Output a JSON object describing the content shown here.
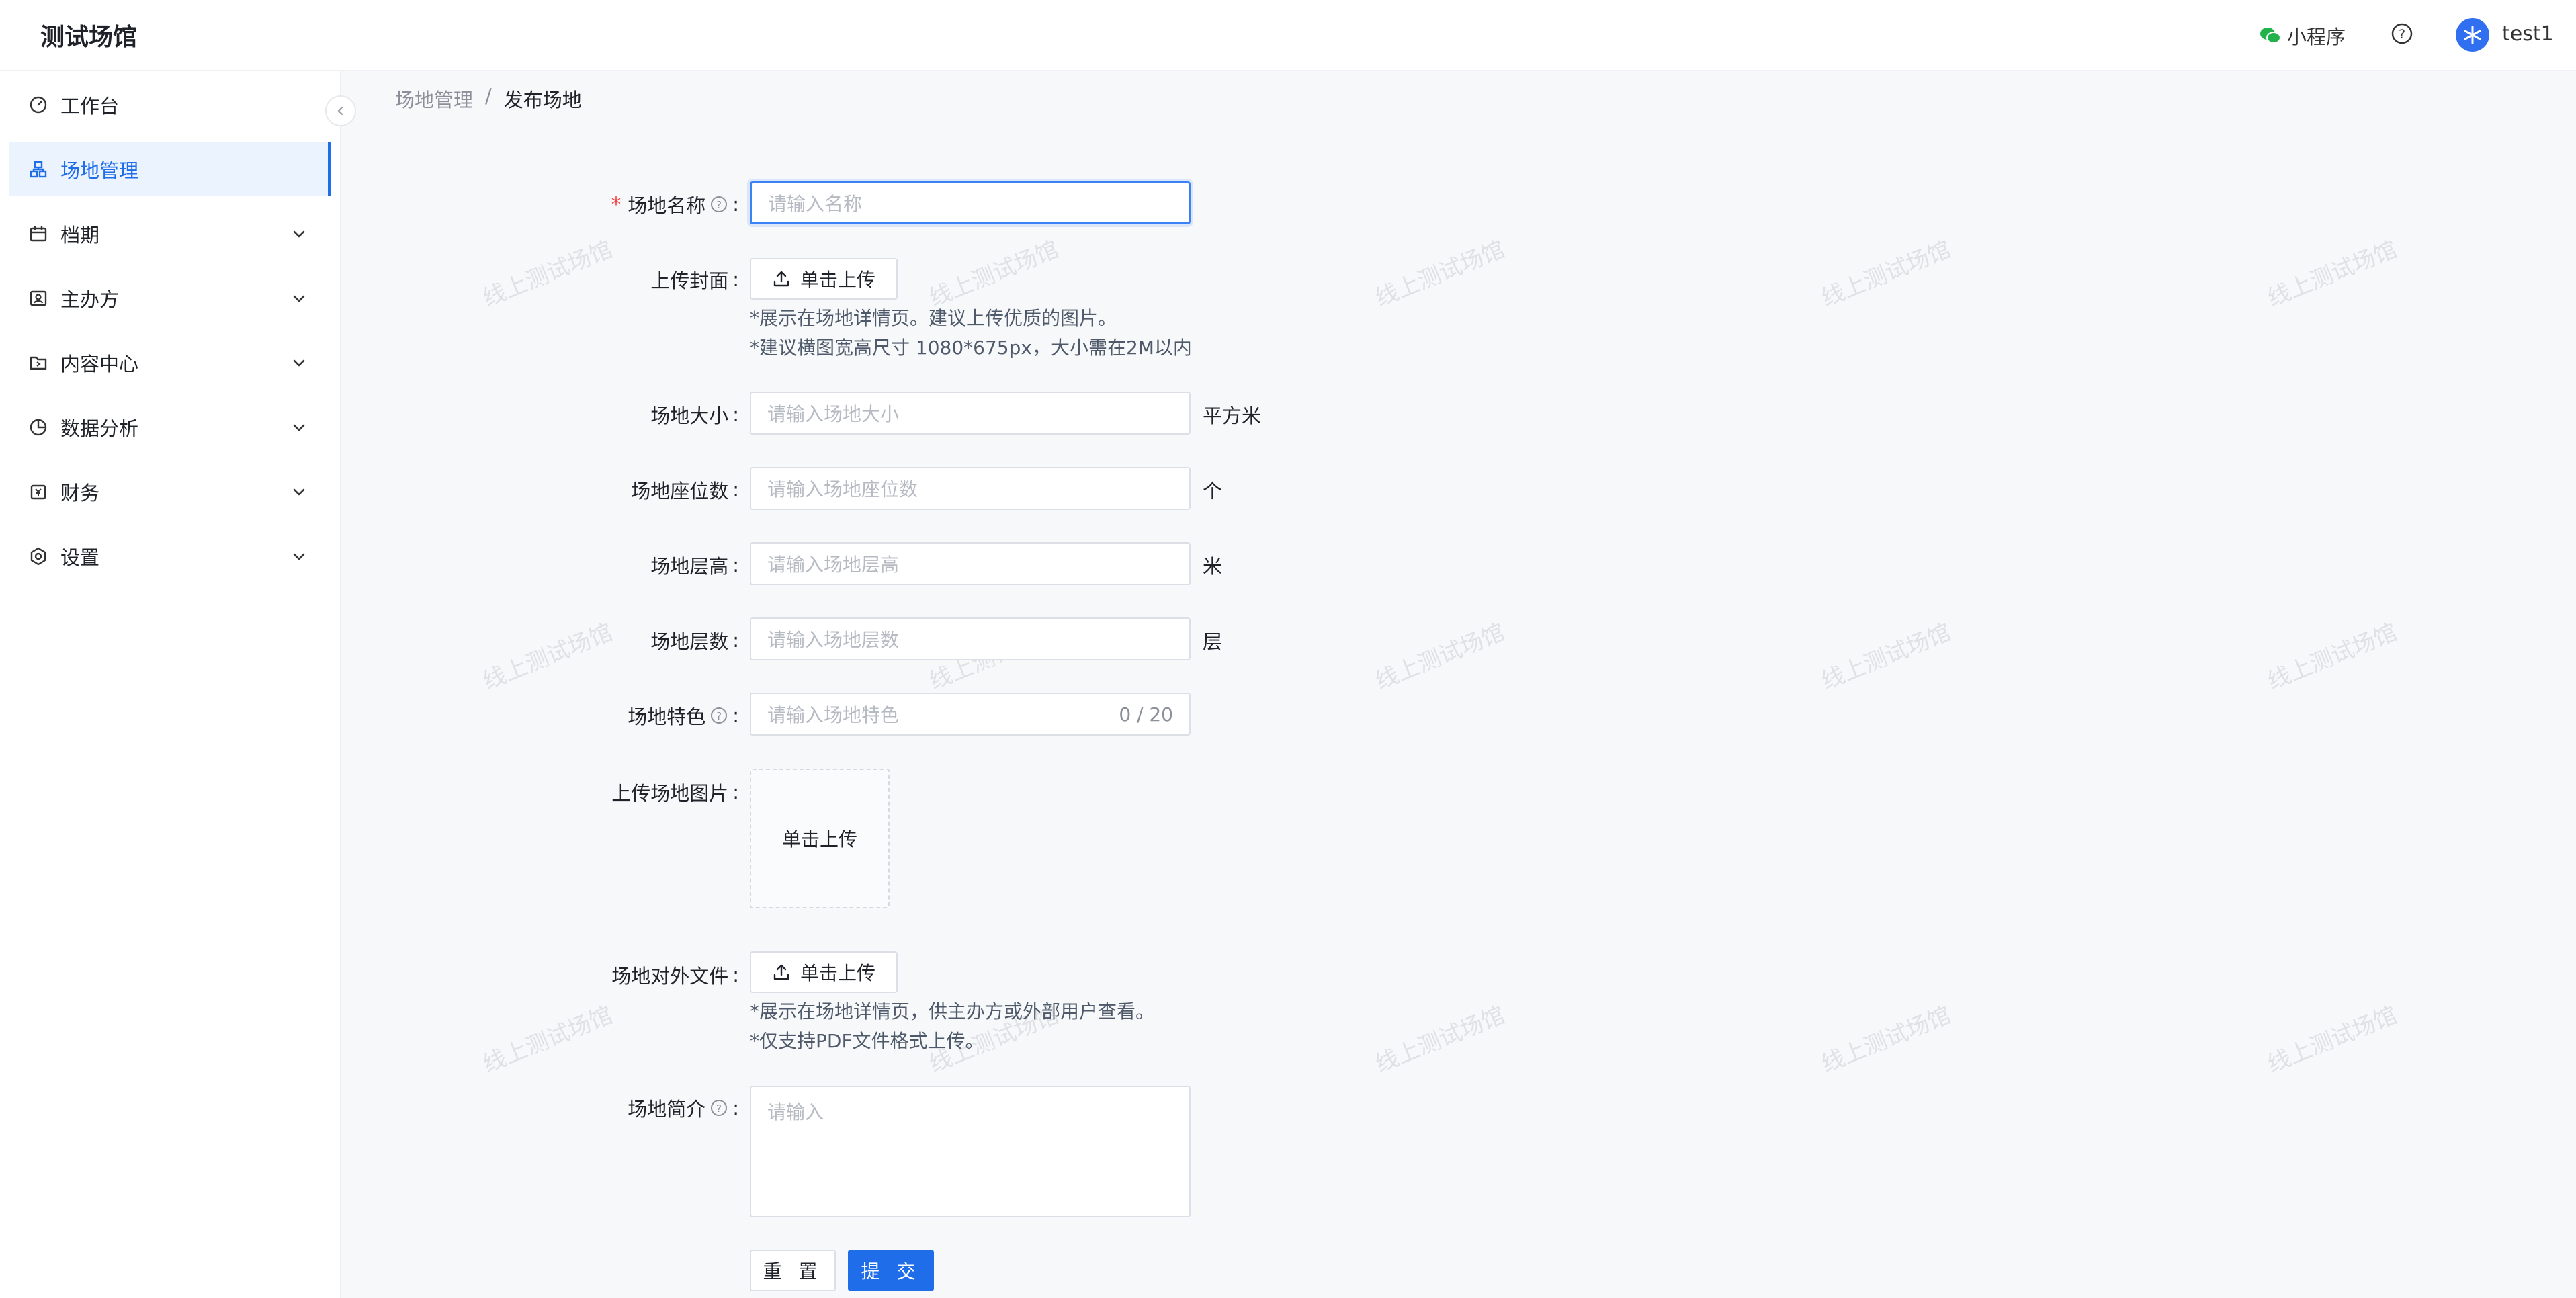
{
  "app": {
    "title": "测试场馆"
  },
  "header": {
    "mini_program": "小程序",
    "username": "test1"
  },
  "sidebar": {
    "items": [
      {
        "label": "工作台",
        "icon": "dashboard-icon",
        "expandable": false,
        "active": false
      },
      {
        "label": "场地管理",
        "icon": "venue-icon",
        "expandable": false,
        "active": true
      },
      {
        "label": "档期",
        "icon": "calendar-icon",
        "expandable": true,
        "active": false
      },
      {
        "label": "主办方",
        "icon": "organizer-icon",
        "expandable": true,
        "active": false
      },
      {
        "label": "内容中心",
        "icon": "folder-icon",
        "expandable": true,
        "active": false
      },
      {
        "label": "数据分析",
        "icon": "pie-chart-icon",
        "expandable": true,
        "active": false
      },
      {
        "label": "财务",
        "icon": "finance-icon",
        "expandable": true,
        "active": false
      },
      {
        "label": "设置",
        "icon": "settings-icon",
        "expandable": true,
        "active": false
      }
    ]
  },
  "breadcrumb": {
    "parent": "场地管理",
    "separator": "/",
    "current": "发布场地"
  },
  "watermark": "线上测试场馆",
  "form": {
    "name": {
      "label": "场地名称",
      "placeholder": "请输入名称",
      "required": "*"
    },
    "cover": {
      "label": "上传封面",
      "button": "单击上传",
      "hint1": "*展示在场地详情页。建议上传优质的图片。",
      "hint2": "*建议横图宽高尺寸 1080*675px，大小需在2M以内"
    },
    "size": {
      "label": "场地大小",
      "placeholder": "请输入场地大小",
      "suffix": "平方米"
    },
    "seats": {
      "label": "场地座位数",
      "placeholder": "请输入场地座位数",
      "suffix": "个"
    },
    "height": {
      "label": "场地层高",
      "placeholder": "请输入场地层高",
      "suffix": "米"
    },
    "floors": {
      "label": "场地层数",
      "placeholder": "请输入场地层数",
      "suffix": "层"
    },
    "feature": {
      "label": "场地特色",
      "placeholder": "请输入场地特色",
      "counter": "0 / 20"
    },
    "images": {
      "label": "上传场地图片",
      "button": "单击上传"
    },
    "files": {
      "label": "场地对外文件",
      "button": "单击上传",
      "hint1": "*展示在场地详情页，供主办方或外部用户查看。",
      "hint2": "*仅支持PDF文件格式上传。"
    },
    "intro": {
      "label": "场地简介",
      "placeholder": "请输入"
    },
    "colon": ":",
    "reset": "重 置",
    "submit": "提 交"
  }
}
